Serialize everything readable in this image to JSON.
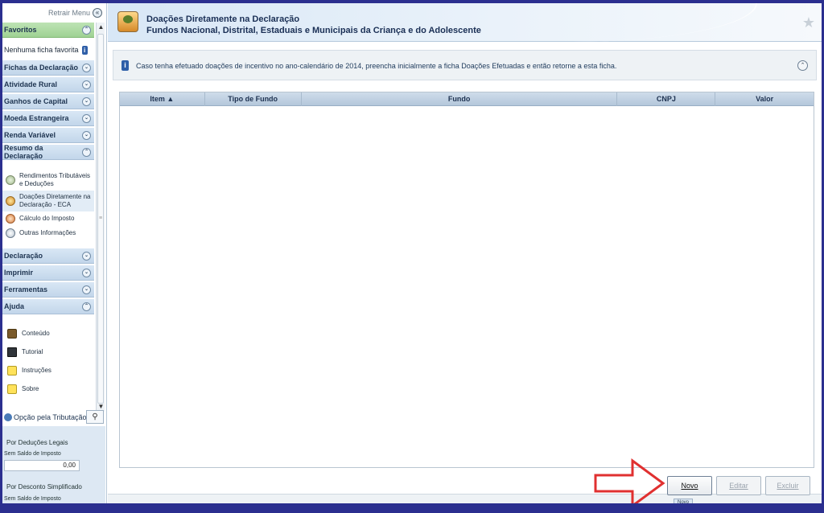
{
  "sidebar": {
    "retrair_label": "Retrair Menu",
    "favoritos": "Favoritos",
    "nenhuma_ficha": "Nenhuma ficha favorita",
    "sections_top": [
      "Fichas da Declaração",
      "Atividade Rural",
      "Ganhos de Capital",
      "Moeda Estrangeira",
      "Renda Variável",
      "Resumo da Declaração"
    ],
    "resumo_items": [
      "Rendimentos Tributáveis e Deduções",
      "Doações Diretamente na Declaração - ECA",
      "Cálculo do Imposto",
      "Outras Informações"
    ],
    "sections_bottom": [
      "Declaração",
      "Imprimir",
      "Ferramentas",
      "Ajuda"
    ],
    "ajuda_items": [
      "Conteúdo",
      "Tutorial",
      "Instruções",
      "Sobre"
    ],
    "opcao_label": "Opção pela Tributação:",
    "deducoes_legais": "Por Deduções Legais",
    "sem_saldo_1": "Sem Saldo de Imposto",
    "valor": "0,00",
    "desconto_simplificado": "Por Desconto Simplificado",
    "sem_saldo_2": "Sem Saldo de Imposto"
  },
  "header": {
    "title_line1": "Doações Diretamente na Declaração",
    "title_line2": "Fundos Nacional, Distrital, Estaduais e Municipais da Criança e do Adolescente"
  },
  "notice": {
    "text": "Caso tenha efetuado doações de incentivo no ano-calendário de 2014, preencha inicialmente a ficha Doações Efetuadas e então retorne a esta ficha."
  },
  "table": {
    "columns": [
      "Item ▲",
      "Tipo de Fundo",
      "Fundo",
      "CNPJ",
      "Valor"
    ],
    "rows": []
  },
  "buttons": {
    "novo": "Novo",
    "editar": "Editar",
    "excluir": "Excluir"
  },
  "mini_novo": "Novo",
  "colors": {
    "frame": "#2b2f8f",
    "favoritos_bg": "#a8d79c",
    "section_bg": "#c9dbee",
    "arrow": "#e03030"
  }
}
